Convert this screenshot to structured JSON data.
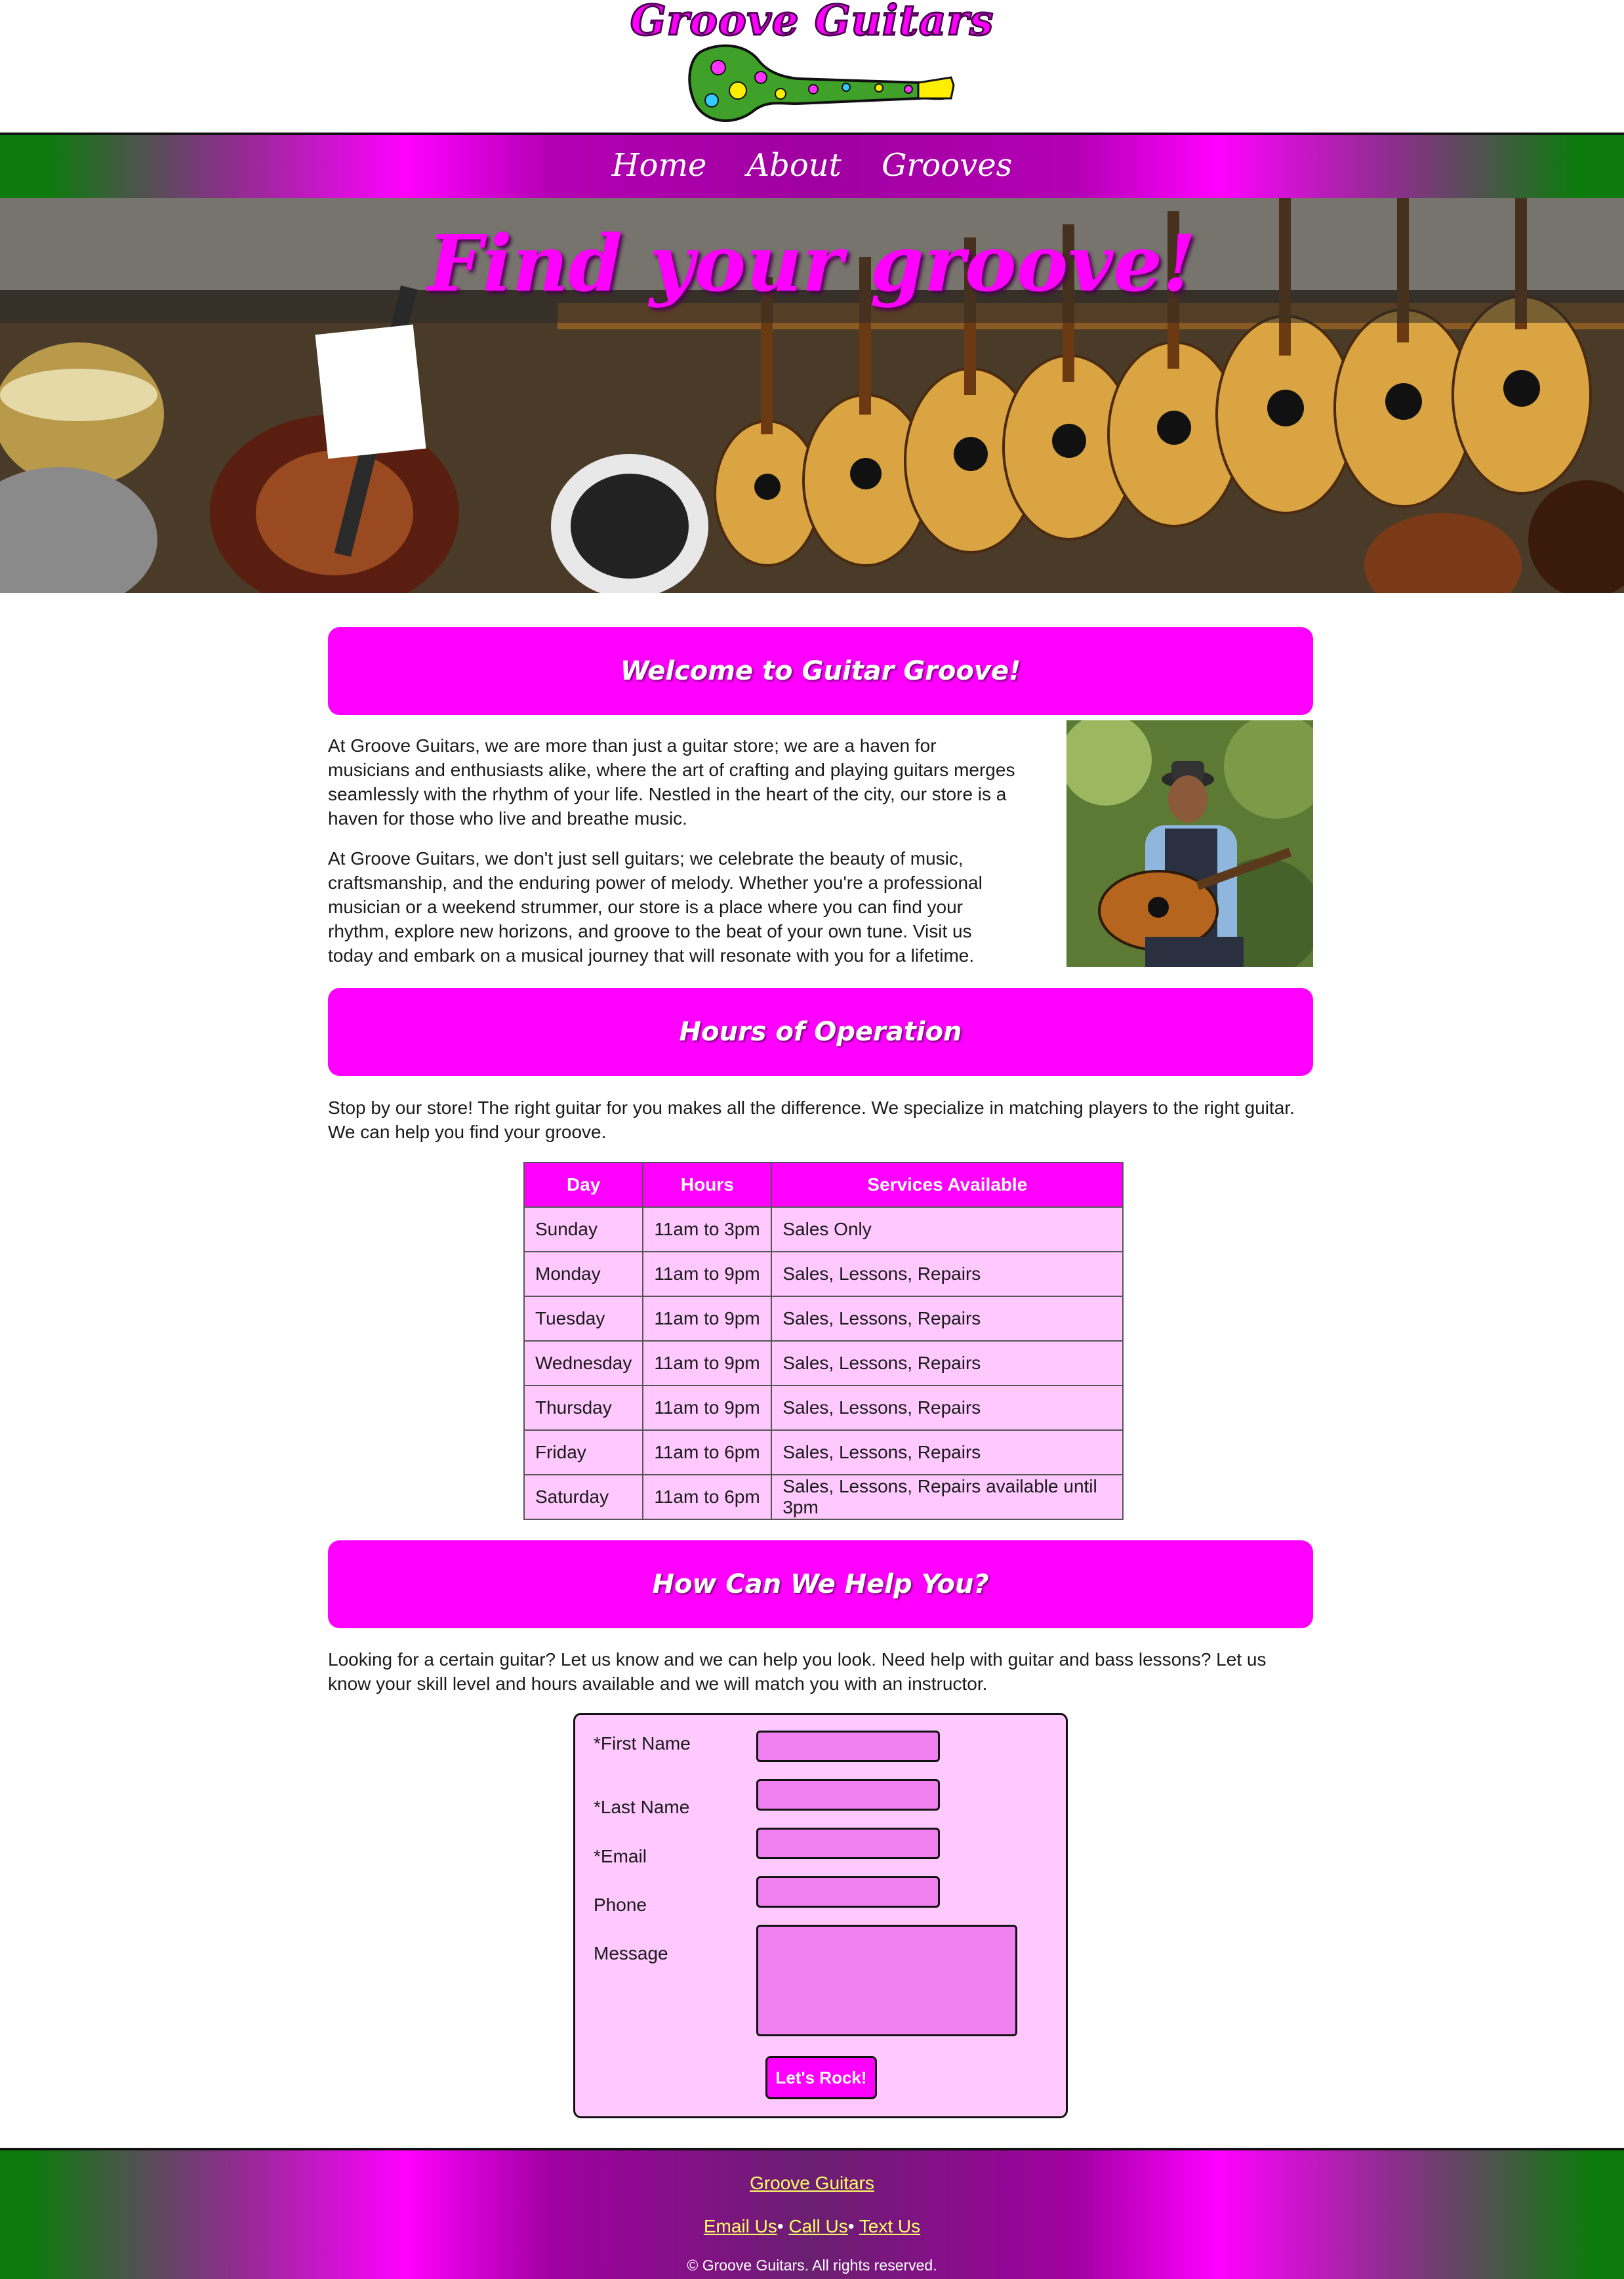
{
  "site": {
    "logo_text": "Groove Guitars"
  },
  "nav": {
    "items": [
      {
        "label": "Home"
      },
      {
        "label": "About"
      },
      {
        "label": "Grooves"
      }
    ]
  },
  "hero": {
    "title": "Find your groove!"
  },
  "welcome": {
    "heading": "Welcome to Guitar Groove!",
    "paragraphs": [
      "At Groove Guitars, we are more than just a guitar store; we are a haven for musicians and enthusiasts alike, where the art of crafting and playing guitars merges seamlessly with the rhythm of your life. Nestled in the heart of the city, our store is a haven for those who live and breathe music.",
      "At Groove Guitars, we don't just sell guitars; we celebrate the beauty of music, craftsmanship, and the enduring power of melody. Whether you're a professional musician or a weekend strummer, our store is a place where you can find your rhythm, explore new horizons, and groove to the beat of your own tune. Visit us today and embark on a musical journey that will resonate with you for a lifetime."
    ]
  },
  "hours": {
    "heading": "Hours of Operation",
    "intro": "Stop by our store! The right guitar for you makes all the difference. We specialize in matching players to the right guitar. We can help you find your groove.",
    "columns": [
      "Day",
      "Hours",
      "Services Available"
    ],
    "rows": [
      [
        "Sunday",
        "11am to 3pm",
        "Sales Only"
      ],
      [
        "Monday",
        "11am to 9pm",
        "Sales, Lessons, Repairs"
      ],
      [
        "Tuesday",
        "11am to 9pm",
        "Sales, Lessons, Repairs"
      ],
      [
        "Wednesday",
        "11am to 9pm",
        "Sales, Lessons, Repairs"
      ],
      [
        "Thursday",
        "11am to 9pm",
        "Sales, Lessons, Repairs"
      ],
      [
        "Friday",
        "11am to 6pm",
        "Sales, Lessons, Repairs"
      ],
      [
        "Saturday",
        "11am to 6pm",
        "Sales, Lessons, Repairs available until 3pm"
      ]
    ]
  },
  "help": {
    "heading": "How Can We Help You?",
    "intro": "Looking for a certain guitar? Let us know and we can help you look. Need help with guitar and bass lessons? Let us know your skill level and hours available and we will match you with an instructor.",
    "form": {
      "first_name_label": "*First Name",
      "last_name_label": "*Last Name",
      "email_label": "*Email",
      "phone_label": "Phone",
      "message_label": "Message",
      "submit_label": "Let's Rock!"
    }
  },
  "footer": {
    "brand_link": "Groove Guitars",
    "email_link": "Email Us",
    "call_link": "Call Us",
    "text_link": "Text Us",
    "separator": "•",
    "copyright": "© Groove Guitars. All rights reserved."
  },
  "colors": {
    "accent": "#ff00ff",
    "table_fill": "#ffc8ff",
    "field_fill": "#f080f0",
    "green": "#0d7a0d",
    "footer_link": "#ffff66"
  },
  "icons": {
    "logo": "guitar-logo-icon"
  }
}
